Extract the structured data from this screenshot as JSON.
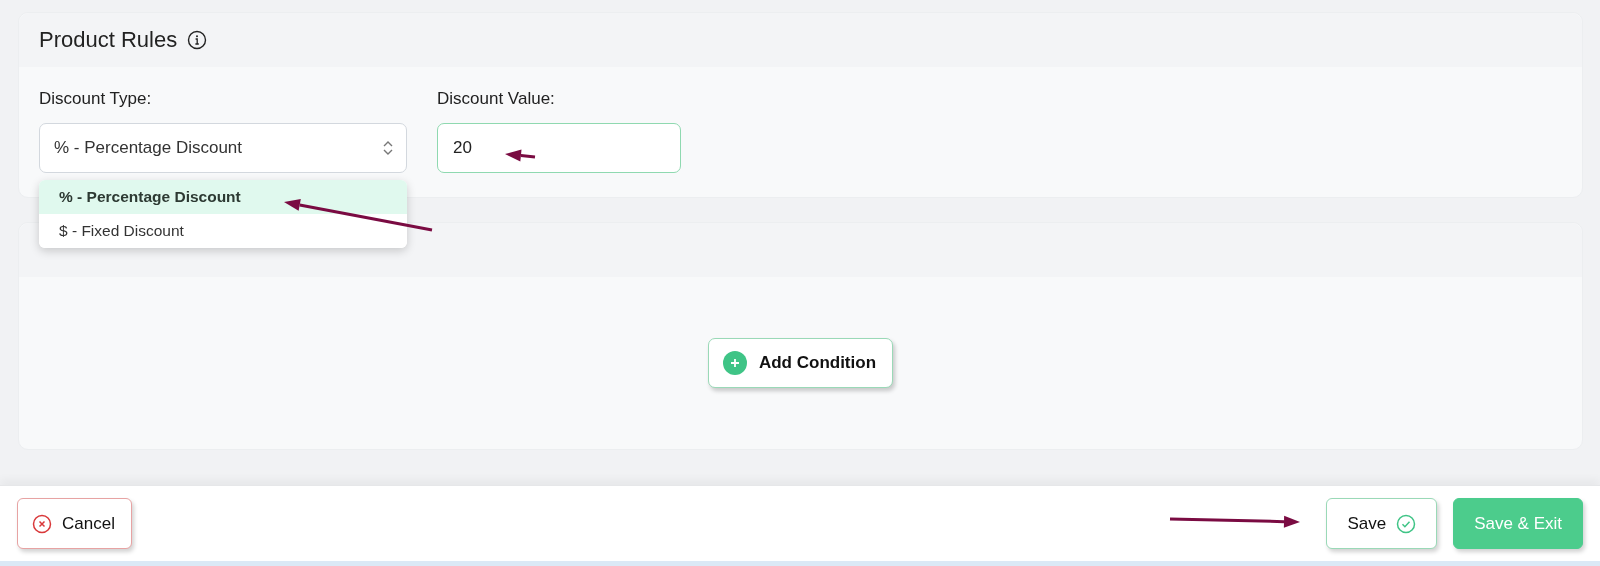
{
  "product_rules": {
    "title": "Product Rules",
    "discount_type": {
      "label": "Discount Type:",
      "value": "% - Percentage Discount",
      "expanded": true,
      "options": [
        {
          "label": "% - Percentage Discount",
          "selected": true
        },
        {
          "label": "$ - Fixed Discount",
          "selected": false
        }
      ]
    },
    "discount_value": {
      "label": "Discount Value:",
      "value": "20"
    }
  },
  "conditions": {
    "add_button": "Add Condition"
  },
  "footer": {
    "cancel": "Cancel",
    "save": "Save",
    "save_exit": "Save & Exit"
  }
}
